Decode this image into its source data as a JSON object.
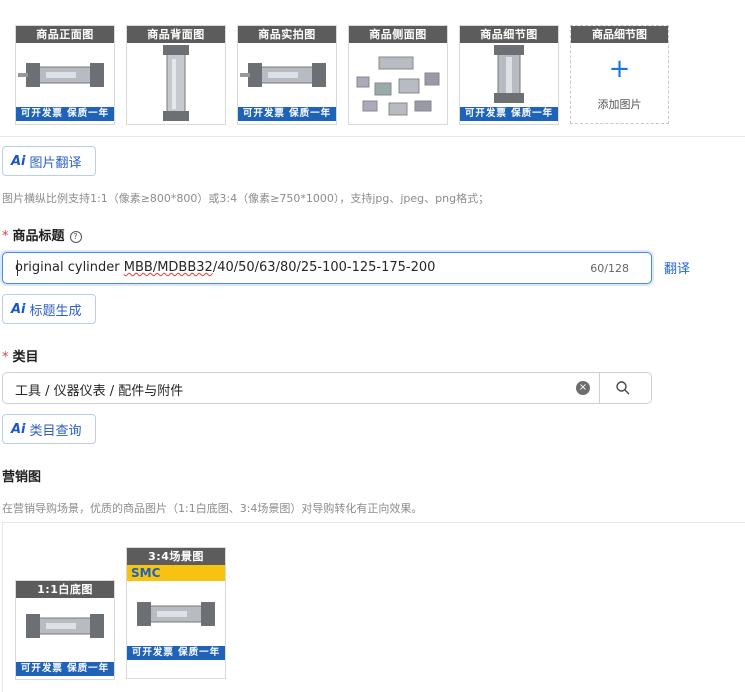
{
  "images": {
    "thumbs": [
      {
        "label": "商品正面图",
        "footer": "可开发票 保质一年",
        "icon": "cylinder-front-photo"
      },
      {
        "label": "商品背面图",
        "footer": "",
        "icon": "cylinder-back-photo"
      },
      {
        "label": "商品实拍图",
        "footer": "可开发票 保质一年",
        "icon": "cylinder-real-photo"
      },
      {
        "label": "商品侧面图",
        "footer": "",
        "icon": "cylinder-parts-diagram"
      },
      {
        "label": "商品细节图",
        "footer": "可开发票 保质一年",
        "icon": "cylinder-detail-photo"
      }
    ],
    "add_slot": {
      "label": "商品细节图",
      "plus": "+",
      "text": "添加图片"
    }
  },
  "ai": {
    "mark": "Ai"
  },
  "image_translate_btn": "图片翻译",
  "image_hint": "图片横纵比例支持1:1（像素≥800*800）或3:4（像素≥750*1000），支持jpg、jpeg、png格式；",
  "title_field": {
    "required_mark": "*",
    "label": "商品标题",
    "help": "?",
    "value_prefix": "original cylinder ",
    "value_squiggle": "MBB/MDBB32",
    "value_suffix": "/40/50/63/80/25-100-125-175-200",
    "count": "60/128",
    "translate": "翻译"
  },
  "title_gen_btn": "标题生成",
  "category": {
    "required_mark": "*",
    "label": "类目",
    "value": "工具 / 仪器仪表 / 配件与附件",
    "clear": "×"
  },
  "category_query_btn": "类目查询",
  "marketing": {
    "label": "营销图",
    "hint": "在营销导购场景，优质的商品图片（1:1白底图、3:4场景图）对导购转化有正向效果。",
    "white_bg_label": "1:1白底图",
    "scene_label": "3:4场景图",
    "footer": "可开发票 保质一年",
    "brand": "SMC"
  },
  "colors": {
    "accent": "#1a73e8",
    "footer_blue": "#1e63b8",
    "required": "#e23c39"
  }
}
